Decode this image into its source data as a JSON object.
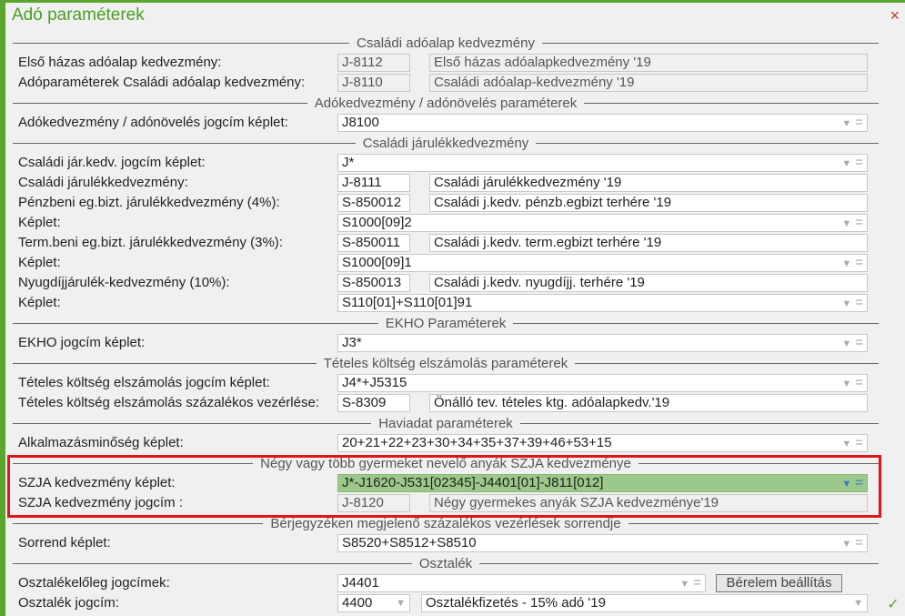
{
  "window": {
    "title": "Adó paraméterek",
    "close_icon": "×",
    "ok_icon": "✓"
  },
  "rows": [
    {
      "type": "header",
      "text": "Családi adóalap kedvezmény"
    },
    {
      "type": "pair",
      "label": "Első házas adóalap kedvezmény:",
      "code": "J-8112",
      "name": "Első házas adóalapkedvezmény        '19",
      "ro": true
    },
    {
      "type": "pair",
      "label": "Adóparaméterek Családi adóalap kedvezmény:",
      "code": "J-8110",
      "name": "Családi adóalap-kedvezmény         '19",
      "ro": true
    },
    {
      "type": "header",
      "text": "Adókedvezmény / adónövelés paraméterek"
    },
    {
      "type": "combo",
      "label": "Adókedvezmény / adónövelés jogcím képlet:",
      "value": "J8100"
    },
    {
      "type": "header",
      "text": "Családi járulékkedvezmény"
    },
    {
      "type": "combo",
      "label": "Családi jár.kedv. jogcím képlet:",
      "value": "J*"
    },
    {
      "type": "pair",
      "label": "Családi járulékkedvezmény:",
      "code": "J-8111",
      "name": "Családi járulékkedvezmény            '19"
    },
    {
      "type": "pair",
      "label": "Pénzbeni eg.bizt. járulékkedvezmény (4%):",
      "code": "S-850012",
      "name": "Családi j.kedv. pénzb.egbizt terhére '19"
    },
    {
      "type": "combo",
      "label": "Képlet:",
      "value": "S1000[09]2"
    },
    {
      "type": "pair",
      "label": "Term.beni eg.bizt. járulékkedvezmény (3%):",
      "code": "S-850011",
      "name": "Családi j.kedv. term.egbizt terhére  '19"
    },
    {
      "type": "combo",
      "label": "Képlet:",
      "value": "S1000[09]1"
    },
    {
      "type": "pair",
      "label": "Nyugdíjjárulék-kedvezmény (10%):",
      "code": "S-850013",
      "name": "Családi j.kedv. nyugdíjj. terhére    '19"
    },
    {
      "type": "combo",
      "label": "Képlet:",
      "value": "S110[01]+S110[01]91"
    },
    {
      "type": "header",
      "text": "EKHO Paraméterek"
    },
    {
      "type": "combo",
      "label": "EKHO jogcím képlet:",
      "value": "J3*"
    },
    {
      "type": "header",
      "text": "Tételes költség elszámolás paraméterek"
    },
    {
      "type": "combo",
      "label": "Tételes költség elszámolás jogcím képlet:",
      "value": "J4*+J5315"
    },
    {
      "type": "pair",
      "label": "Tételes költség elszámolás százalékos vezérlése:",
      "code": "S-8309",
      "name": "Önálló tev. tételes ktg. adóalapkedv.'19"
    },
    {
      "type": "header",
      "text": "Haviadat paraméterek"
    },
    {
      "type": "combo",
      "label": "Alkalmazásminőség képlet:",
      "value": "20+21+22+23+30+34+35+37+39+46+53+15"
    },
    {
      "type": "header",
      "text": "Négy vagy több gyermeket nevelő anyák SZJA kedvezménye"
    },
    {
      "type": "combo",
      "label": "SZJA kedvezmény képlet:",
      "value": "J*-J1620-J531[02345]-J4401[01]-J811[012]",
      "highlight": true
    },
    {
      "type": "pair",
      "label": "SZJA kedvezmény jogcím :",
      "code": "J-8120",
      "name": "Négy gyermekes anyák SZJA kedvezménye'19",
      "ro": true
    },
    {
      "type": "header",
      "text": "Bérjegyzéken megjelenő százalékos vezérlések sorrendje"
    },
    {
      "type": "combo",
      "label": "Sorrend képlet:",
      "value": "S8520+S8512+S8510"
    },
    {
      "type": "header",
      "text": "Osztalék"
    },
    {
      "type": "combobtn",
      "label": "Osztalékelőleg jogcímek:",
      "value": "J4401",
      "button": "Bérelem beállítás"
    },
    {
      "type": "selects",
      "label": "Osztalék jogcím:",
      "code": "4400",
      "name": "Osztalékfizetés - 15% adó            '19"
    }
  ]
}
